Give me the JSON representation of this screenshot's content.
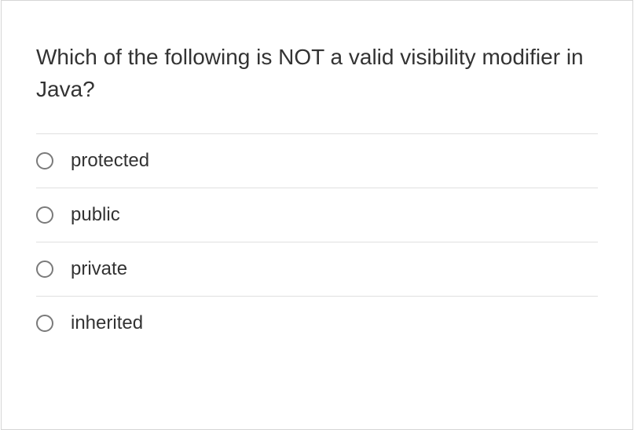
{
  "question": {
    "text": "Which of the following is NOT a valid visibility modifier in Java?",
    "options": [
      {
        "label": "protected"
      },
      {
        "label": "public"
      },
      {
        "label": "private"
      },
      {
        "label": "inherited"
      }
    ]
  }
}
